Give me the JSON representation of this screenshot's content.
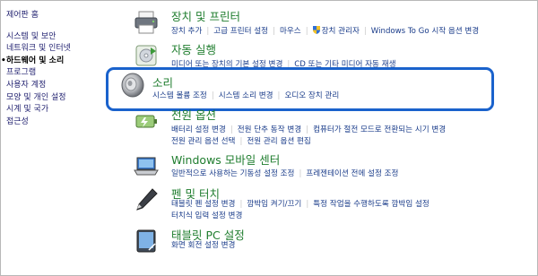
{
  "sidebar": {
    "items": [
      {
        "label": "제어판 홈"
      },
      {
        "label": "시스템 및 보안"
      },
      {
        "label": "네트워크 및 인터넷"
      },
      {
        "label": "하드웨어 및 소리"
      },
      {
        "label": "프로그램"
      },
      {
        "label": "사용자 계정"
      },
      {
        "label": "모양 및 개인 설정"
      },
      {
        "label": "시계 및 국가"
      },
      {
        "label": "접근성"
      }
    ]
  },
  "categories": {
    "devices": {
      "title": "장치 및 프린터",
      "links": [
        "장치 추가",
        "고급 프린터 설정",
        "마우스",
        "장치 관리자",
        "Windows To Go 시작 옵션 변경"
      ]
    },
    "autoplay": {
      "title": "자동 실행",
      "links": [
        "미디어 또는 장치의 기본 설정 변경",
        "CD 또는 기타 미디어 자동 재생"
      ]
    },
    "sound": {
      "title": "소리",
      "links": [
        "시스템 볼륨 조정",
        "시스템 소리 변경",
        "오디오 장치 관리"
      ]
    },
    "power": {
      "title": "전원 옵션",
      "links_row1": [
        "배터리 설정 변경",
        "전원 단추 동작 변경",
        "컴퓨터가 절전 모드로 전환되는 시기 변경"
      ],
      "links_row2": [
        "전원 관리 옵션 선택",
        "전원 관리 옵션 편집"
      ]
    },
    "mobility": {
      "title": "Windows 모바일 센터",
      "links": [
        "일반적으로 사용하는 기동성 설정 조정",
        "프레젠테이션 전에 설정 조정"
      ]
    },
    "pen": {
      "title": "펜 및 터치",
      "links_row1": [
        "태블릿 펜 설정 변경",
        "깜박임 켜기/끄기",
        "특정 작업을 수행하도록 깜박임 설정"
      ],
      "links_row2": [
        "터치식 입력 설정 변경"
      ]
    },
    "tablet": {
      "title": "태블릿 PC 설정",
      "links": [
        "화면 회전 설정 변경"
      ]
    }
  },
  "colors": {
    "category_title": "#1f7d2e",
    "link": "#1a3c8a",
    "highlight_border": "#1a62cc"
  },
  "icons": [
    "printer-icon",
    "autoplay-icon",
    "speaker-icon",
    "power-icon",
    "mobility-center-icon",
    "pen-touch-icon",
    "tablet-pc-icon",
    "shield-icon"
  ]
}
